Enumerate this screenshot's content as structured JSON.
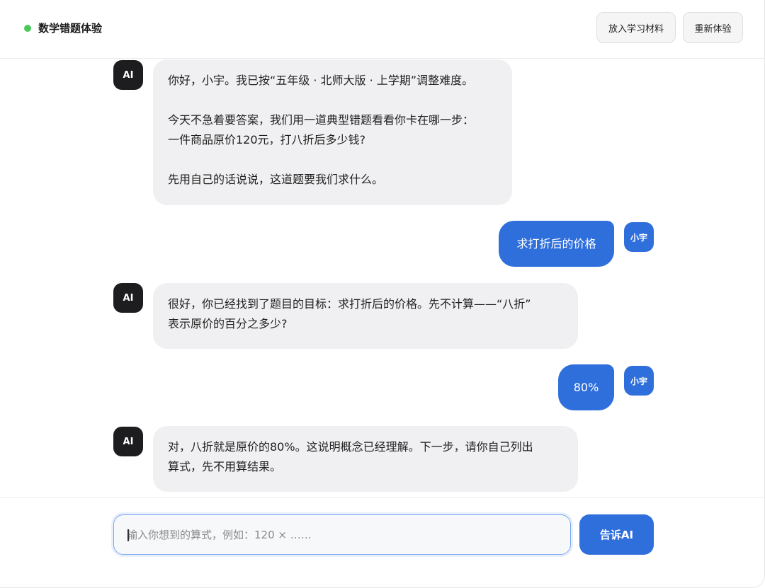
{
  "header": {
    "title": "数学错题体验",
    "status_color": "#4cc85a",
    "buttons": {
      "add_material": "放入学习材料",
      "restart": "重新体验"
    }
  },
  "avatars": {
    "ai": "AI",
    "user": "小宇"
  },
  "messages": [
    {
      "role": "ai",
      "text": "你好，小宇。我已按“五年级 · 北师大版 · 上学期”调整难度。\n\n今天不急着要答案，我们用一道典型错题看看你卡在哪一步：\n一件商品原价120元，打八折后多少钱?\n\n先用自己的话说说，这道题要我们求什么。"
    },
    {
      "role": "user",
      "text": "求打折后的价格"
    },
    {
      "role": "ai",
      "text": "很好，你已经找到了题目的目标：求打折后的价格。先不计算——“八折”\n表示原价的百分之多少?"
    },
    {
      "role": "user",
      "text": "80%"
    },
    {
      "role": "ai",
      "text": "对，八折就是原价的80%。这说明概念已经理解。下一步，请你自己列出\n算式，先不用算结果。"
    }
  ],
  "composer": {
    "placeholder": "输入你想到的算式，例如：120 × ……",
    "send_label": "告诉AI"
  },
  "colors": {
    "accent": "#2f6fdc",
    "ai_bubble": "#f0f0f2",
    "ai_avatar": "#1d1d1f"
  }
}
